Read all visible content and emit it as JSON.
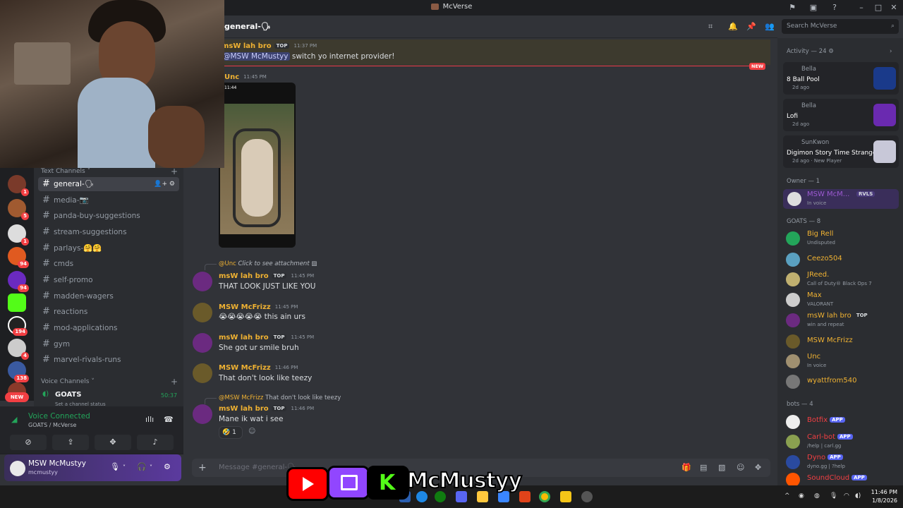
{
  "window": {
    "title": "McVerse"
  },
  "header": {
    "channel": "general-🗣",
    "search_placeholder": "Search McVerse"
  },
  "sidebar": {
    "text_category": "Text Channels",
    "channels": [
      {
        "name": "general-🗣",
        "selected": true
      },
      {
        "name": "media-📷"
      },
      {
        "name": "panda-buy-suggestions"
      },
      {
        "name": "stream-suggestions"
      },
      {
        "name": "parlays-🤗🤗"
      },
      {
        "name": "cmds"
      },
      {
        "name": "self-promo"
      },
      {
        "name": "madden-wagers"
      },
      {
        "name": "reactions"
      },
      {
        "name": "mod-applications"
      },
      {
        "name": "gym"
      },
      {
        "name": "marvel-rivals-runs"
      }
    ],
    "voice_category": "Voice Channels",
    "voice_channel": {
      "name": "GOATS",
      "status": "Set a channel status",
      "time": "50:37"
    }
  },
  "servers": {
    "badges": [
      "1",
      "5",
      "1",
      "94",
      "94",
      "",
      "194",
      "4",
      "138"
    ],
    "new_label": "NEW"
  },
  "voice_panel": {
    "title": "Voice Connected",
    "subtitle": "GOATS / McVerse"
  },
  "user_panel": {
    "name": "MSW McMustyy",
    "username": "mcmustyy"
  },
  "messages": {
    "m1": {
      "author": "msW lah bro",
      "tag": "TOP",
      "time": "11:37 PM",
      "mention": "@MSW McMustyy",
      "text": "switch yo internet provider!"
    },
    "new_label": "NEW",
    "m2": {
      "author": "Unc",
      "time": "11:45 PM",
      "photo_clock": "11:44"
    },
    "m3": {
      "reply_to": "@Unc",
      "reply_text": "Click to see attachment",
      "author": "msW lah bro",
      "tag": "TOP",
      "time": "11:45 PM",
      "text": "THAT LOOK JUST LIKE YOU"
    },
    "m4": {
      "author": "MSW McFrizz",
      "time": "11:45 PM",
      "text": "😭😭😭😭😭 this ain urs"
    },
    "m5": {
      "author": "msW lah bro",
      "tag": "TOP",
      "time": "11:45 PM",
      "text": "She got ur smile bruh"
    },
    "m6": {
      "author": "MSW McFrizz",
      "time": "11:46 PM",
      "text": "That don't look like teezy"
    },
    "m7": {
      "reply_to": "@MSW McFrizz",
      "reply_text": "That don't look like teezy",
      "author": "msW lah bro",
      "tag": "TOP",
      "time": "11:46 PM",
      "text": "Mane ik wat i see",
      "reaction_emoji": "🤣",
      "reaction_count": "1"
    }
  },
  "input": {
    "placeholder": "Message #general-🗣"
  },
  "members": {
    "activity_header": "Activity — 24",
    "activities": [
      {
        "user": "Bella",
        "game": "8 Ball Pool",
        "when": "2d ago"
      },
      {
        "user": "Bella",
        "game": "Lofi",
        "when": "2d ago"
      },
      {
        "user": "SunKwon",
        "game": "Digimon Story Time Stranger",
        "when": "2d ago",
        "extra": "New Player"
      }
    ],
    "owner_header": "Owner — 1",
    "owner": {
      "name": "MSW McM...",
      "tag": "RVLS",
      "status": "In voice"
    },
    "goats_header": "GOATS — 8",
    "goats": [
      {
        "name": "Big Rell",
        "status": "Undisputed"
      },
      {
        "name": "Ceezo504",
        "status": ""
      },
      {
        "name": "JReed.",
        "status": "Call of Duty® Black Ops 7"
      },
      {
        "name": "Max",
        "status": "VALORANT"
      },
      {
        "name": "msW lah bro",
        "tag": "TOP",
        "status": "win and repeat"
      },
      {
        "name": "MSW McFrizz",
        "status": ""
      },
      {
        "name": "Unc",
        "status": "In voice"
      },
      {
        "name": "wyattfrom540",
        "status": ""
      }
    ],
    "bots_header": "bots — 4",
    "bots": [
      {
        "name": "Botfix",
        "tag": "APP",
        "status": ""
      },
      {
        "name": "Carl-bot",
        "tag": "APP",
        "status": "/help | carl.gg"
      },
      {
        "name": "Dyno",
        "tag": "APP",
        "status": "dyno.gg | ?help"
      },
      {
        "name": "SoundCloud",
        "tag": "APP",
        "status": ""
      }
    ]
  },
  "overlay": {
    "brand": "McMustyy"
  },
  "taskbar": {
    "time": "11:46 PM",
    "date": "1/8/2026"
  },
  "colors": {
    "accent": "#5865f2",
    "online": "#23a55a",
    "gold": "#f0b232",
    "danger": "#f23f43"
  }
}
